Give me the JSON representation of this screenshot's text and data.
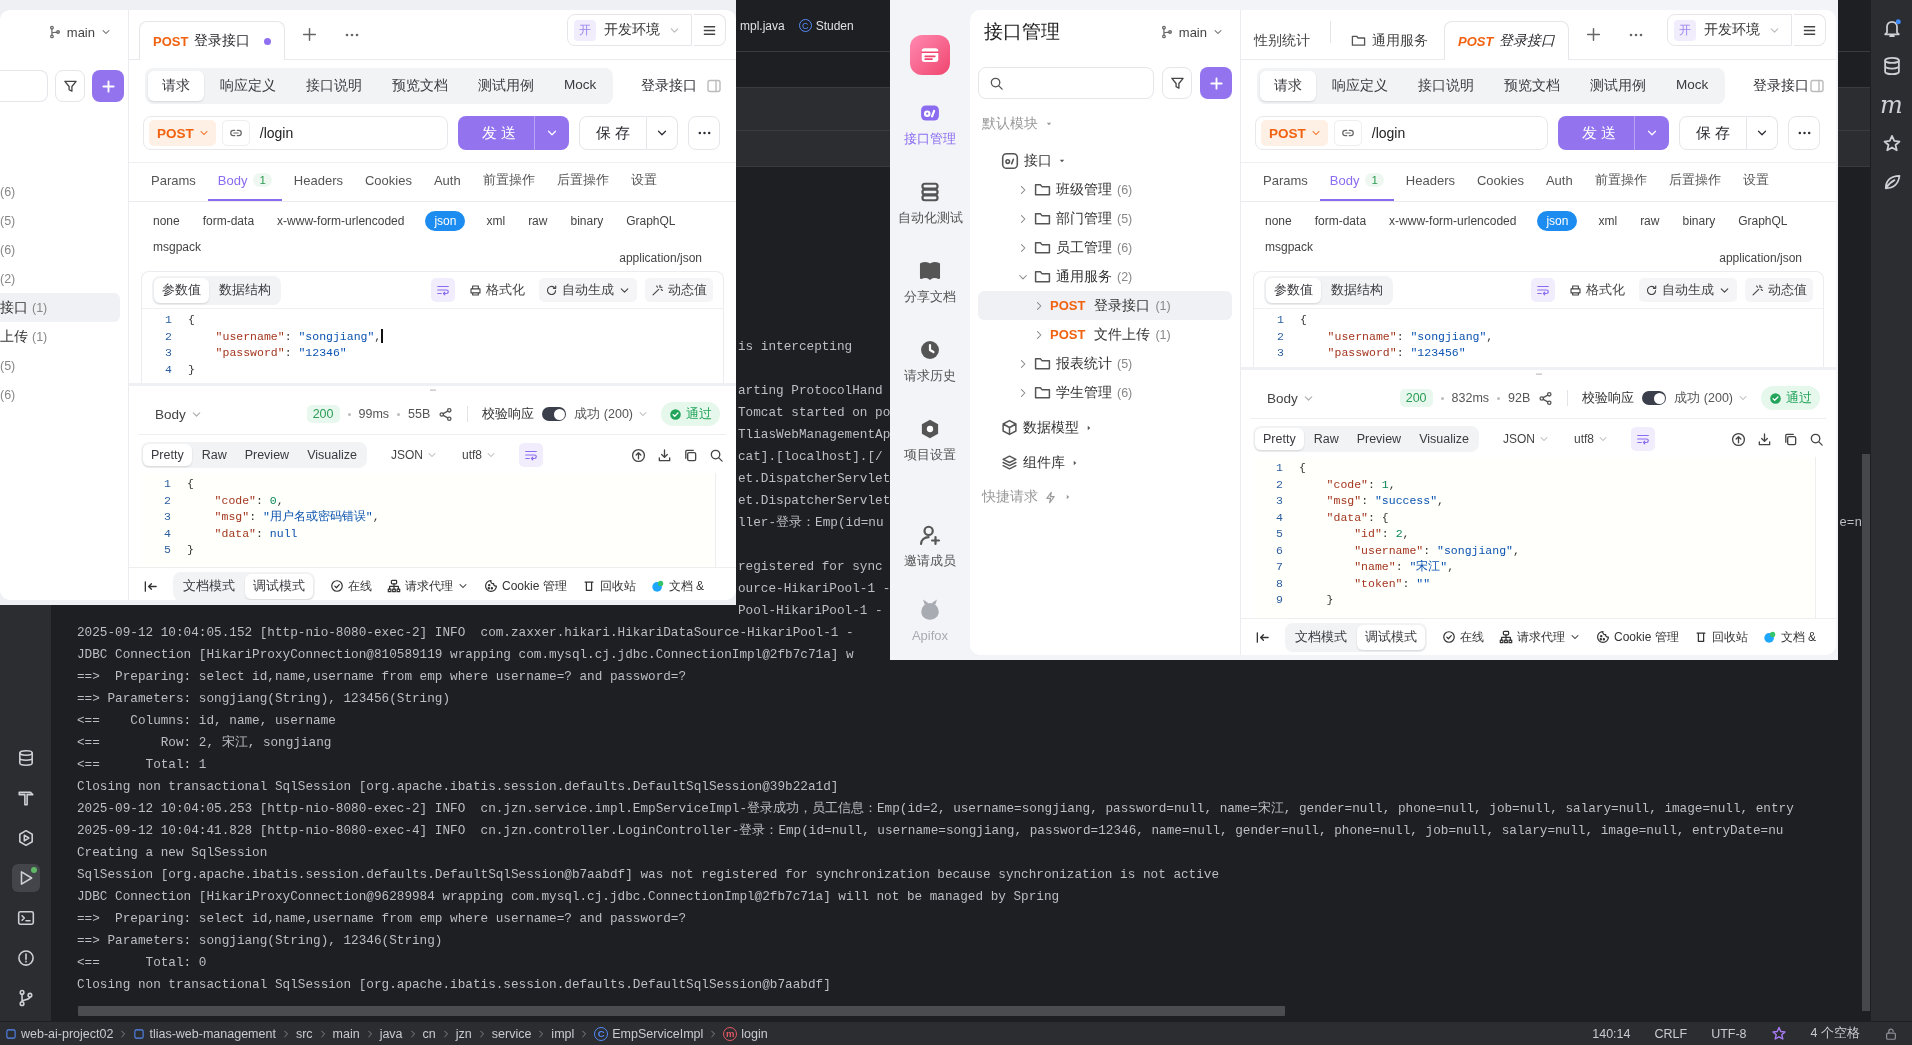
{
  "ide": {
    "editor_tabs": [
      {
        "label": "mpl.java"
      },
      {
        "label": "Studen",
        "icon_text": "C"
      }
    ],
    "tool_icons": [
      {
        "kind": "database",
        "selected": false
      },
      {
        "kind": "build",
        "selected": false
      },
      {
        "kind": "services",
        "selected": false
      },
      {
        "kind": "run",
        "selected": true
      },
      {
        "kind": "terminal",
        "selected": false
      },
      {
        "kind": "problems",
        "selected": false
      },
      {
        "kind": "git",
        "selected": false
      }
    ],
    "side_icons": [
      {
        "kind": "bell"
      },
      {
        "kind": "database"
      },
      {
        "kind": "letter",
        "text": "m"
      },
      {
        "kind": "ai"
      },
      {
        "kind": "leaf"
      }
    ],
    "console": {
      "fragments": [
        {
          "kind": "text",
          "text": "is intercepting"
        },
        {
          "kind": "blank"
        },
        {
          "kind": "text",
          "text": "arting ProtocolHand"
        },
        {
          "kind": "text",
          "text": "Tomcat started on po"
        },
        {
          "kind": "text",
          "text": "TliasWebManagementAp"
        },
        {
          "kind": "text",
          "text": "cat].[localhost].[/"
        },
        {
          "kind": "text",
          "text": "et.DispatcherServlet"
        },
        {
          "kind": "text",
          "text": "et.DispatcherServlet"
        },
        {
          "kind": "text",
          "text": "ller-登录：Emp(id=nu",
          "edge": "e=n"
        },
        {
          "kind": "blank"
        },
        {
          "kind": "text",
          "text": "registered for sync"
        },
        {
          "kind": "text",
          "text": "ource-HikariPool-1 -"
        },
        {
          "kind": "text",
          "text": "Pool-HikariPool-1 -"
        }
      ],
      "lines": [
        "2025-09-12 10:04:05.152 [http-nio-8080-exec-2] INFO  com.zaxxer.hikari.HikariDataSource-HikariPool-1 -",
        "JDBC Connection [HikariProxyConnection@810589119 wrapping com.mysql.cj.jdbc.ConnectionImpl@2fb7c71a] w",
        "==>  Preparing: select id,name,username from emp where username=? and password=?",
        "==> Parameters: songjiang(String), 123456(String)",
        "<==    Columns: id, name, username",
        "<==        Row: 2, 宋江, songjiang",
        "<==      Total: 1",
        "Closing non transactional SqlSession [org.apache.ibatis.session.defaults.DefaultSqlSession@39b22a1d]",
        "2025-09-12 10:04:05.253 [http-nio-8080-exec-2] INFO  cn.jzn.service.impl.EmpServiceImpl-登录成功，员工信息：Emp(id=2, username=songjiang, password=null, name=宋江, gender=null, phone=null, job=null, salary=null, image=null, entry",
        "2025-09-12 10:04:41.828 [http-nio-8080-exec-4] INFO  cn.jzn.controller.LoginController-登录：Emp(id=null, username=songjiang, password=12346, name=null, gender=null, phone=null, job=null, salary=null, image=null, entryDate=nu",
        "Creating a new SqlSession",
        "SqlSession [org.apache.ibatis.session.defaults.DefaultSqlSession@b7aabdf] was not registered for synchronization because synchronization is not active",
        "JDBC Connection [HikariProxyConnection@96289984 wrapping com.mysql.cj.jdbc.ConnectionImpl@2fb7c71a] will not be managed by Spring",
        "==>  Preparing: select id,name,username from emp where username=? and password=?",
        "==> Parameters: songjiang(String), 12346(String)",
        "<==      Total: 0",
        "Closing non transactional SqlSession [org.apache.ibatis.session.defaults.DefaultSqlSession@b7aabdf]"
      ]
    },
    "status_bar": {
      "breadcrumbs": [
        {
          "kind": "module",
          "label": "web-ai-project02"
        },
        {
          "kind": "module",
          "label": "tlias-web-management"
        },
        {
          "kind": "folder",
          "label": "src"
        },
        {
          "kind": "folder",
          "label": "main"
        },
        {
          "kind": "folder",
          "label": "java"
        },
        {
          "kind": "folder",
          "label": "cn"
        },
        {
          "kind": "folder",
          "label": "jzn"
        },
        {
          "kind": "folder",
          "label": "service"
        },
        {
          "kind": "folder",
          "label": "impl"
        },
        {
          "kind": "class",
          "label": "EmpServiceImpl",
          "icon_text": "C"
        },
        {
          "kind": "method",
          "label": "login",
          "icon_text": "m"
        }
      ],
      "position": "140:14",
      "line_separator": "CRLF",
      "encoding": "UTF-8",
      "indent": "4 个空格"
    }
  },
  "windows": [
    {
      "kind": "partial_sidebar",
      "sidebar": {
        "branch": "main",
        "items": [
          {
            "count": "(6)",
            "selected": false
          },
          {
            "count": "(5)",
            "selected": false
          },
          {
            "count": "(6)",
            "selected": false
          },
          {
            "count": "(2)",
            "selected": false
          },
          {
            "name": "接口",
            "count": "(1)",
            "selected": true
          },
          {
            "name": "上传",
            "count": "(1)",
            "selected": false
          },
          {
            "count": "(5)",
            "selected": false
          },
          {
            "count": "(6)",
            "selected": false
          }
        ]
      },
      "panel": {
        "tabs": [
          {
            "kind": "api",
            "method": "POST",
            "label": "登录接口",
            "selected": true,
            "unsaved": true,
            "preview": false
          }
        ],
        "environment": {
          "badge": "开",
          "label": "开发环境"
        },
        "sections": [
          {
            "label": "请求",
            "selected": true
          },
          {
            "label": "响应定义",
            "selected": false
          },
          {
            "label": "接口说明",
            "selected": false
          },
          {
            "label": "预览文档",
            "selected": false
          },
          {
            "label": "测试用例",
            "selected": false
          },
          {
            "label": "Mock",
            "selected": false
          }
        ],
        "api_name": "登录接口",
        "request": {
          "method": "POST",
          "path": "/login",
          "send": "发 送",
          "save": "保 存"
        },
        "param_tabs": [
          {
            "label": "Params",
            "selected": false
          },
          {
            "label": "Body",
            "count": "1",
            "selected": true
          },
          {
            "label": "Headers",
            "selected": false
          },
          {
            "label": "Cookies",
            "selected": false
          },
          {
            "label": "Auth",
            "selected": false
          },
          {
            "label": "前置操作",
            "selected": false
          },
          {
            "label": "后置操作",
            "selected": false
          },
          {
            "label": "设置",
            "selected": false
          }
        ],
        "body_types": [
          {
            "label": "none",
            "selected": false
          },
          {
            "label": "form-data",
            "selected": false
          },
          {
            "label": "x-www-form-urlencoded",
            "selected": false
          },
          {
            "label": "json",
            "selected": true
          },
          {
            "label": "xml",
            "selected": false
          },
          {
            "label": "raw",
            "selected": false
          },
          {
            "label": "binary",
            "selected": false
          },
          {
            "label": "GraphQL",
            "selected": false
          },
          {
            "label": "msgpack",
            "selected": false
          }
        ],
        "content_type": "application/json",
        "editor": {
          "views": [
            {
              "label": "参数值",
              "selected": true
            },
            {
              "label": "数据结构",
              "selected": false
            }
          ],
          "tools": [
            {
              "kind": "format",
              "label": "格式化"
            },
            {
              "kind": "generate",
              "label": "自动生成"
            },
            {
              "kind": "dynamic",
              "label": "动态值"
            }
          ],
          "lines": [
            {
              "number": "1",
              "cursor": false,
              "tokens": [
                {
                  "kind": "punct",
                  "text": "{"
                }
              ]
            },
            {
              "number": "2",
              "cursor": true,
              "tokens": [
                {
                  "kind": "key",
                  "text": "    \"username\""
                },
                {
                  "kind": "punct",
                  "text": ": "
                },
                {
                  "kind": "string",
                  "text": "\"songjiang\""
                },
                {
                  "kind": "punct",
                  "text": ","
                }
              ]
            },
            {
              "number": "3",
              "cursor": false,
              "tokens": [
                {
                  "kind": "key",
                  "text": "    \"password\""
                },
                {
                  "kind": "punct",
                  "text": ": "
                },
                {
                  "kind": "string",
                  "text": "\"12346\""
                }
              ]
            },
            {
              "number": "4",
              "cursor": false,
              "tokens": [
                {
                  "kind": "punct",
                  "text": "}"
                }
              ]
            }
          ]
        },
        "response": {
          "view": "Body",
          "status": "200",
          "time": "99ms",
          "size": "55B",
          "validate": {
            "label": "校验响应",
            "on": true
          },
          "expected": "成功 (200)",
          "result": "通过",
          "formats": [
            {
              "label": "Pretty",
              "selected": true
            },
            {
              "label": "Raw",
              "selected": false
            },
            {
              "label": "Preview",
              "selected": false
            },
            {
              "label": "Visualize",
              "selected": false
            }
          ],
          "language": "JSON",
          "encoding": "utf8",
          "lines": [
            {
              "number": "1",
              "tokens": [
                {
                  "kind": "punct",
                  "text": "{"
                }
              ]
            },
            {
              "number": "2",
              "tokens": [
                {
                  "kind": "key",
                  "text": "    \"code\""
                },
                {
                  "kind": "punct",
                  "text": ": "
                },
                {
                  "kind": "number",
                  "text": "0"
                },
                {
                  "kind": "punct",
                  "text": ","
                }
              ]
            },
            {
              "number": "3",
              "tokens": [
                {
                  "kind": "key",
                  "text": "    \"msg\""
                },
                {
                  "kind": "punct",
                  "text": ": "
                },
                {
                  "kind": "string",
                  "text": "\"用户名或密码错误\""
                },
                {
                  "kind": "punct",
                  "text": ","
                }
              ]
            },
            {
              "number": "4",
              "tokens": [
                {
                  "kind": "key",
                  "text": "    \"data\""
                },
                {
                  "kind": "punct",
                  "text": ": "
                },
                {
                  "kind": "keyword",
                  "text": "null"
                }
              ]
            },
            {
              "number": "5",
              "tokens": [
                {
                  "kind": "punct",
                  "text": "}"
                }
              ]
            }
          ]
        },
        "bottom": {
          "modes": [
            {
              "label": "文档模式",
              "selected": false
            },
            {
              "label": "调试模式",
              "selected": true
            }
          ],
          "tools": [
            {
              "kind": "online",
              "label": "在线"
            },
            {
              "kind": "proxy",
              "label": "请求代理"
            },
            {
              "kind": "cookie",
              "label": "Cookie 管理"
            },
            {
              "kind": "trash",
              "label": "回收站"
            },
            {
              "kind": "docs",
              "label": "文档 &"
            }
          ]
        }
      }
    },
    {
      "kind": "full_sidebar",
      "rail": [
        {
          "kind": "api",
          "label": "接口管理",
          "selected": true
        },
        {
          "kind": "automation",
          "label": "自动化测试",
          "selected": false
        },
        {
          "kind": "docs",
          "label": "分享文档",
          "selected": false
        },
        {
          "kind": "history",
          "label": "请求历史",
          "selected": false
        },
        {
          "kind": "settings",
          "label": "项目设置",
          "selected": false
        },
        {
          "kind": "invite",
          "label": "邀请成员",
          "selected": false
        }
      ],
      "brand": "Apifox",
      "tree": {
        "title": "接口管理",
        "branch": "main",
        "module": "默认模块",
        "root": {
          "label": "接口",
          "expanded": true,
          "selected": false,
          "children": [
            {
              "kind": "folder",
              "label": "班级管理",
              "count": "(6)",
              "expanded": false,
              "selected": false
            },
            {
              "kind": "folder",
              "label": "部门管理",
              "count": "(5)",
              "expanded": false,
              "selected": false
            },
            {
              "kind": "folder",
              "label": "员工管理",
              "count": "(6)",
              "expanded": false,
              "selected": false
            },
            {
              "kind": "folder",
              "label": "通用服务",
              "count": "(2)",
              "expanded": true,
              "selected": false,
              "children": [
                {
                  "kind": "api",
                  "method": "POST",
                  "label": "登录接口",
                  "count": "(1)",
                  "expanded": false,
                  "selected": true
                },
                {
                  "kind": "api",
                  "method": "POST",
                  "label": "文件上传",
                  "count": "(1)",
                  "expanded": false,
                  "selected": false
                }
              ]
            },
            {
              "kind": "folder",
              "label": "报表统计",
              "count": "(5)",
              "expanded": false,
              "selected": false
            },
            {
              "kind": "folder",
              "label": "学生管理",
              "count": "(6)",
              "expanded": false,
              "selected": false
            }
          ]
        },
        "sections": [
          {
            "kind": "models",
            "label": "数据模型"
          },
          {
            "kind": "components",
            "label": "组件库"
          }
        ],
        "quick": "快捷请求"
      },
      "panel": {
        "tabs": [
          {
            "kind": "partial",
            "label": "性别统计",
            "selected": false,
            "unsaved": false,
            "preview": false
          },
          {
            "kind": "folder",
            "label": "通用服务",
            "selected": false,
            "unsaved": false,
            "preview": false
          },
          {
            "kind": "api",
            "method": "POST",
            "label": "登录接口",
            "selected": true,
            "unsaved": false,
            "preview": true
          }
        ],
        "environment": {
          "badge": "开",
          "label": "开发环境"
        },
        "sections": [
          {
            "label": "请求",
            "selected": true
          },
          {
            "label": "响应定义",
            "selected": false
          },
          {
            "label": "接口说明",
            "selected": false
          },
          {
            "label": "预览文档",
            "selected": false
          },
          {
            "label": "测试用例",
            "selected": false
          },
          {
            "label": "Mock",
            "selected": false
          }
        ],
        "api_name": "登录接口",
        "request": {
          "method": "POST",
          "path": "/login",
          "send": "发 送",
          "save": "保 存"
        },
        "param_tabs": [
          {
            "label": "Params",
            "selected": false
          },
          {
            "label": "Body",
            "count": "1",
            "selected": true
          },
          {
            "label": "Headers",
            "selected": false
          },
          {
            "label": "Cookies",
            "selected": false
          },
          {
            "label": "Auth",
            "selected": false
          },
          {
            "label": "前置操作",
            "selected": false
          },
          {
            "label": "后置操作",
            "selected": false
          },
          {
            "label": "设置",
            "selected": false
          }
        ],
        "body_types": [
          {
            "label": "none",
            "selected": false
          },
          {
            "label": "form-data",
            "selected": false
          },
          {
            "label": "x-www-form-urlencoded",
            "selected": false
          },
          {
            "label": "json",
            "selected": true
          },
          {
            "label": "xml",
            "selected": false
          },
          {
            "label": "raw",
            "selected": false
          },
          {
            "label": "binary",
            "selected": false
          },
          {
            "label": "GraphQL",
            "selected": false
          },
          {
            "label": "msgpack",
            "selected": false
          }
        ],
        "content_type": "application/json",
        "editor": {
          "views": [
            {
              "label": "参数值",
              "selected": true
            },
            {
              "label": "数据结构",
              "selected": false
            }
          ],
          "tools": [
            {
              "kind": "format",
              "label": "格式化"
            },
            {
              "kind": "generate",
              "label": "自动生成"
            },
            {
              "kind": "dynamic",
              "label": "动态值"
            }
          ],
          "lines": [
            {
              "number": "1",
              "cursor": false,
              "tokens": [
                {
                  "kind": "punct",
                  "text": "{"
                }
              ]
            },
            {
              "number": "2",
              "cursor": false,
              "tokens": [
                {
                  "kind": "key",
                  "text": "    \"username\""
                },
                {
                  "kind": "punct",
                  "text": ": "
                },
                {
                  "kind": "string",
                  "text": "\"songjiang\""
                },
                {
                  "kind": "punct",
                  "text": ","
                }
              ]
            },
            {
              "number": "3",
              "cursor": false,
              "tokens": [
                {
                  "kind": "key",
                  "text": "    \"password\""
                },
                {
                  "kind": "punct",
                  "text": ": "
                },
                {
                  "kind": "string",
                  "text": "\"123456\""
                }
              ]
            }
          ]
        },
        "response": {
          "view": "Body",
          "status": "200",
          "time": "832ms",
          "size": "92B",
          "validate": {
            "label": "校验响应",
            "on": true
          },
          "expected": "成功 (200)",
          "result": "通过",
          "formats": [
            {
              "label": "Pretty",
              "selected": true
            },
            {
              "label": "Raw",
              "selected": false
            },
            {
              "label": "Preview",
              "selected": false
            },
            {
              "label": "Visualize",
              "selected": false
            }
          ],
          "language": "JSON",
          "encoding": "utf8",
          "lines": [
            {
              "number": "1",
              "tokens": [
                {
                  "kind": "punct",
                  "text": "{"
                }
              ]
            },
            {
              "number": "2",
              "tokens": [
                {
                  "kind": "key",
                  "text": "    \"code\""
                },
                {
                  "kind": "punct",
                  "text": ": "
                },
                {
                  "kind": "number",
                  "text": "1"
                },
                {
                  "kind": "punct",
                  "text": ","
                }
              ]
            },
            {
              "number": "3",
              "tokens": [
                {
                  "kind": "key",
                  "text": "    \"msg\""
                },
                {
                  "kind": "punct",
                  "text": ": "
                },
                {
                  "kind": "string",
                  "text": "\"success\""
                },
                {
                  "kind": "punct",
                  "text": ","
                }
              ]
            },
            {
              "number": "4",
              "tokens": [
                {
                  "kind": "key",
                  "text": "    \"data\""
                },
                {
                  "kind": "punct",
                  "text": ": {"
                }
              ]
            },
            {
              "number": "5",
              "tokens": [
                {
                  "kind": "key",
                  "text": "        \"id\""
                },
                {
                  "kind": "punct",
                  "text": ": "
                },
                {
                  "kind": "number",
                  "text": "2"
                },
                {
                  "kind": "punct",
                  "text": ","
                }
              ]
            },
            {
              "number": "6",
              "tokens": [
                {
                  "kind": "key",
                  "text": "        \"username\""
                },
                {
                  "kind": "punct",
                  "text": ": "
                },
                {
                  "kind": "string",
                  "text": "\"songjiang\""
                },
                {
                  "kind": "punct",
                  "text": ","
                }
              ]
            },
            {
              "number": "7",
              "tokens": [
                {
                  "kind": "key",
                  "text": "        \"name\""
                },
                {
                  "kind": "punct",
                  "text": ": "
                },
                {
                  "kind": "string",
                  "text": "\"宋江\""
                },
                {
                  "kind": "punct",
                  "text": ","
                }
              ]
            },
            {
              "number": "8",
              "tokens": [
                {
                  "kind": "key",
                  "text": "        \"token\""
                },
                {
                  "kind": "punct",
                  "text": ": "
                },
                {
                  "kind": "string",
                  "text": "\"\""
                }
              ]
            },
            {
              "number": "9",
              "tokens": [
                {
                  "kind": "punct",
                  "text": "    }"
                }
              ]
            }
          ]
        },
        "bottom": {
          "modes": [
            {
              "label": "文档模式",
              "selected": false
            },
            {
              "label": "调试模式",
              "selected": true
            }
          ],
          "tools": [
            {
              "kind": "online",
              "label": "在线"
            },
            {
              "kind": "proxy",
              "label": "请求代理"
            },
            {
              "kind": "cookie",
              "label": "Cookie 管理"
            },
            {
              "kind": "trash",
              "label": "回收站"
            },
            {
              "kind": "docs",
              "label": "文档 &"
            }
          ]
        }
      }
    }
  ]
}
